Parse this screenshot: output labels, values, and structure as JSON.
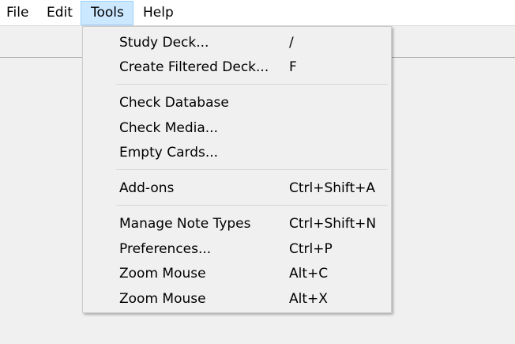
{
  "menubar": {
    "items": [
      {
        "label": "File"
      },
      {
        "label": "Edit"
      },
      {
        "label": "Tools"
      },
      {
        "label": "Help"
      }
    ]
  },
  "tools_menu": {
    "groups": [
      [
        {
          "label": "Study Deck...",
          "shortcut": "/"
        },
        {
          "label": "Create Filtered Deck...",
          "shortcut": "F"
        }
      ],
      [
        {
          "label": "Check Database",
          "shortcut": ""
        },
        {
          "label": "Check Media...",
          "shortcut": ""
        },
        {
          "label": "Empty Cards...",
          "shortcut": ""
        }
      ],
      [
        {
          "label": "Add-ons",
          "shortcut": "Ctrl+Shift+A"
        }
      ],
      [
        {
          "label": "Manage Note Types",
          "shortcut": "Ctrl+Shift+N"
        },
        {
          "label": "Preferences...",
          "shortcut": "Ctrl+P"
        },
        {
          "label": "Zoom Mouse",
          "shortcut": "Alt+C"
        },
        {
          "label": "Zoom Mouse",
          "shortcut": "Alt+X"
        }
      ]
    ]
  },
  "colors": {
    "menubar_bg": "#ffffff",
    "active_highlight": "#cce8ff",
    "active_border": "#99d1ff",
    "menu_bg": "#f0f0f0",
    "separator": "#d7d7d7"
  }
}
